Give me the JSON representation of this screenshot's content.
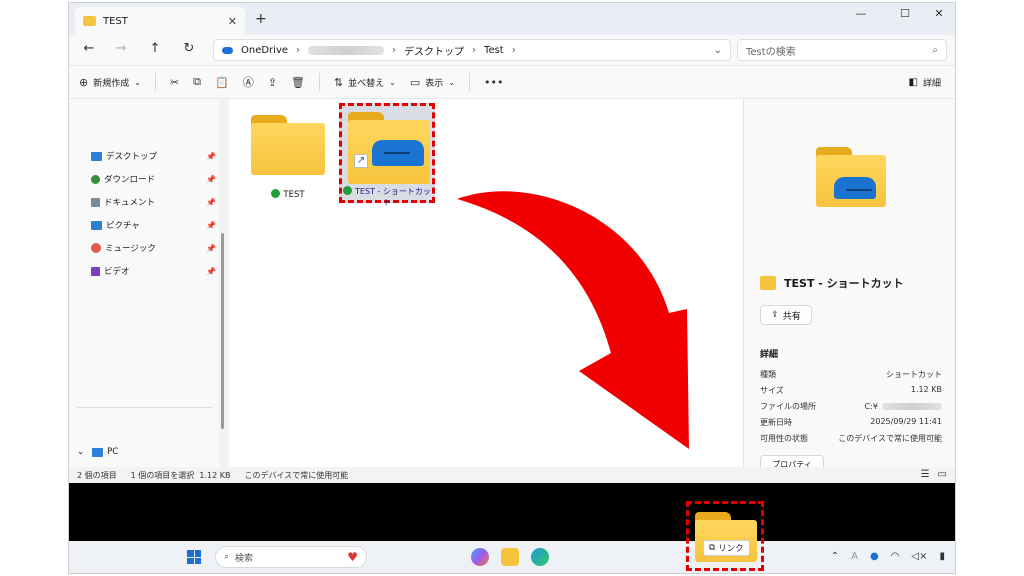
{
  "window": {
    "tab_title": "TEST",
    "new_tab": "+",
    "minimize": "—",
    "maximize": "☐",
    "close": "✕"
  },
  "address": {
    "breadcrumbs": [
      "OneDrive",
      "デスクトップ",
      "Test"
    ],
    "search_placeholder": "Testの検索"
  },
  "commands": {
    "new": "新規作成",
    "sort": "並べ替え",
    "view": "表示",
    "more": "•••",
    "details": "詳細"
  },
  "sidebar": {
    "items": [
      {
        "label": "デスクトップ",
        "color": "#2b7fd8"
      },
      {
        "label": "ダウンロード",
        "color": "#2f8f3a"
      },
      {
        "label": "ドキュメント",
        "color": "#7a8a9a"
      },
      {
        "label": "ピクチャ",
        "color": "#2f7fd0"
      },
      {
        "label": "ミュージック",
        "color": "#e35d4a"
      },
      {
        "label": "ビデオ",
        "color": "#7b3fc4"
      }
    ],
    "pc_label": "PC"
  },
  "files": [
    {
      "name": "TEST"
    },
    {
      "name": "TEST - ショートカット"
    }
  ],
  "preview": {
    "title": "TEST - ショートカット",
    "share_label": "共有",
    "section": "詳細",
    "rows": [
      {
        "key": "種類",
        "value": "ショートカット"
      },
      {
        "key": "サイズ",
        "value": "1.12 KB"
      },
      {
        "key": "ファイルの場所",
        "value": "C:¥"
      },
      {
        "key": "更新日時",
        "value": "2025/09/29 11:41"
      },
      {
        "key": "可用性の状態",
        "value": "このデバイスで常に使用可能"
      }
    ],
    "properties": "プロパティ"
  },
  "status": {
    "items_count": "2 個の項目",
    "selected": "1 個の項目を選択  1.12 KB",
    "availability": "このデバイスで常に使用可能"
  },
  "taskbar": {
    "search_label": "検索"
  },
  "drag": {
    "tooltip": "リンク"
  },
  "colors": {
    "accent": "#1a6fd6",
    "highlight_red": "#e00000",
    "folder_yellow": "#f6c33d"
  }
}
